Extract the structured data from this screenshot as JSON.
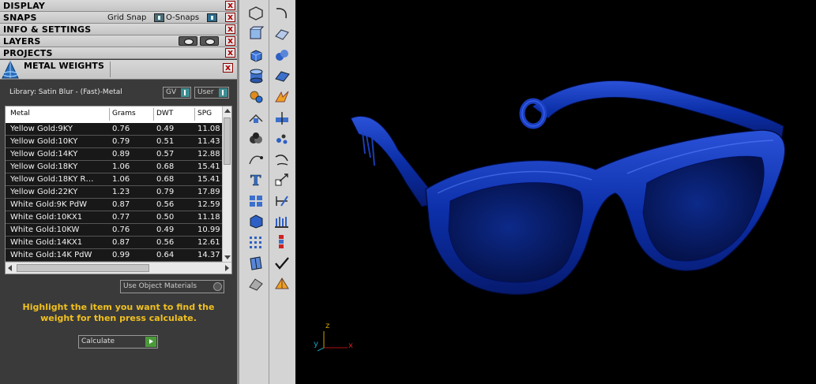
{
  "panel": {
    "sections": [
      {
        "title": "DISPLAY"
      },
      {
        "title": "SNAPS"
      },
      {
        "title": "INFO & SETTINGS"
      },
      {
        "title": "LAYERS"
      },
      {
        "title": "PROJECTS"
      }
    ],
    "close_glyph": "x",
    "snaps": {
      "grid_snap_label": "Grid Snap",
      "osnaps_label": "O-Snaps"
    }
  },
  "metal_weights": {
    "title": "METAL WEIGHTS",
    "library_label": "Library: Satin Blur - (Fast)-Metal",
    "gv_label": "GV",
    "user_label": "User",
    "columns": [
      "Metal",
      "Grams",
      "DWT",
      "SPG"
    ],
    "rows": [
      [
        "Yellow Gold:9KY",
        "0.76",
        "0.49",
        "11.08"
      ],
      [
        "Yellow Gold:10KY",
        "0.79",
        "0.51",
        "11.43"
      ],
      [
        "Yellow Gold:14KY",
        "0.89",
        "0.57",
        "12.88"
      ],
      [
        "Yellow Gold:18KY",
        "1.06",
        "0.68",
        "15.41"
      ],
      [
        "Yellow Gold:18KY R…",
        "1.06",
        "0.68",
        "15.41"
      ],
      [
        "Yellow Gold:22KY",
        "1.23",
        "0.79",
        "17.89"
      ],
      [
        "White Gold:9K PdW",
        "0.87",
        "0.56",
        "12.59"
      ],
      [
        "White Gold:10KX1",
        "0.77",
        "0.50",
        "11.18"
      ],
      [
        "White Gold:10KW",
        "0.76",
        "0.49",
        "10.99"
      ],
      [
        "White Gold:14KX1",
        "0.87",
        "0.56",
        "12.61"
      ],
      [
        "White Gold:14K PdW",
        "0.99",
        "0.64",
        "14.37"
      ]
    ],
    "use_object_materials_label": "Use Object Materials",
    "hint": "Highlight the item you want to find the weight for then press calculate.",
    "calculate_label": "Calculate"
  },
  "toolbar": {
    "tools_left": [
      "polygon-icon",
      "box-edit-icon",
      "cube-icon",
      "cylinder-icon",
      "gear-puzzle-icon",
      "trim-icon",
      "boolean-icon",
      "curve-point-icon",
      "text-icon",
      "array-icon",
      "solid-icon",
      "grid-array-icon",
      "prism-icon",
      "mesh-icon"
    ],
    "tools_right": [
      "curve-icon",
      "surface-icon",
      "sphere-group-icon",
      "plane-icon",
      "spark-icon",
      "split-icon",
      "dots-icon",
      "arc-icon",
      "scale-icon",
      "measure-icon",
      "bar-chart-icon",
      "stack-icon",
      "check-icon",
      "pyramid-icon"
    ]
  },
  "viewport": {
    "axis_x_label": "x",
    "axis_y_label": "y",
    "axis_z_label": "z",
    "model_color": "#0a2a9a"
  },
  "colors": {
    "hint": "#f0c020",
    "panel_bg": "#3a3a3a",
    "toolbar_bg": "#d4d4d4"
  }
}
